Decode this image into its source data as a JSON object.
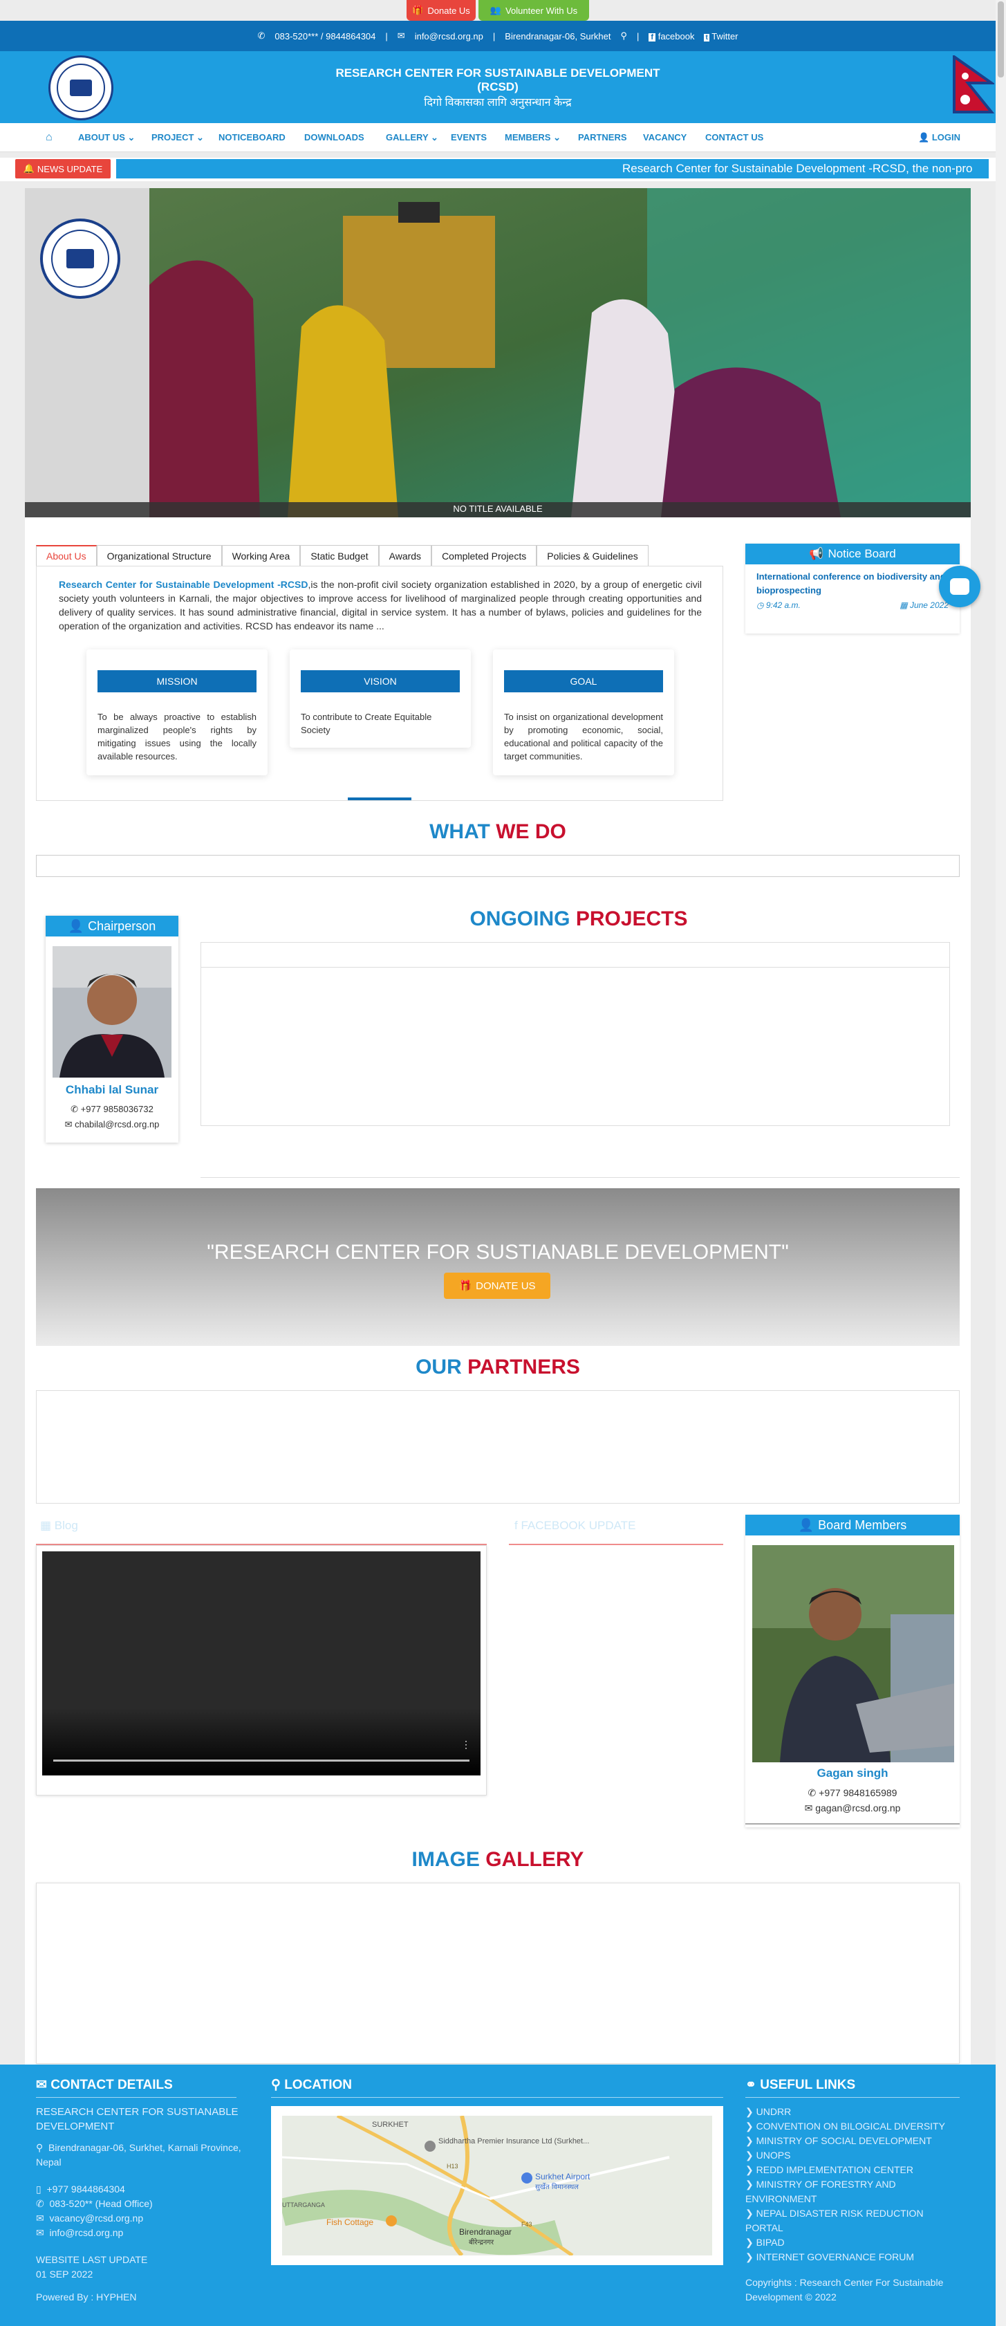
{
  "top": {
    "donate": "Donate Us",
    "volunteer": "Volunteer With Us"
  },
  "strip": {
    "phone": "083-520*** / 9844864304",
    "email": "info@rcsd.org.np",
    "address": "Birendranagar-06, Surkhet",
    "facebook": "facebook",
    "twitter": "Twitter"
  },
  "header": {
    "title": "RESEARCH CENTER FOR SUSTAINABLE DEVELOPMENT",
    "abbr": "(RCSD)",
    "nepali": "दिगो विकासका लागि अनुसन्धान केन्द्र"
  },
  "nav": {
    "items": [
      "ABOUT US",
      "PROJECT",
      "NOTICEBOARD",
      "DOWNLOADS",
      "GALLERY",
      "EVENTS",
      "MEMBERS",
      "PARTNERS",
      "VACANCY",
      "CONTACT US"
    ],
    "login": "LOGIN"
  },
  "news": {
    "label": "NEWS UPDATE",
    "ticker": "Research Center for Sustainable Development -RCSD, the non-pro"
  },
  "hero": {
    "caption": "NO TITLE AVAILABLE"
  },
  "about": {
    "tabs": [
      "About Us",
      "Organizational Structure",
      "Working Area",
      "Static Budget",
      "Awards",
      "Completed Projects",
      "Policies & Guidelines"
    ],
    "org_name": "Research Center for Sustainable Development -RCSD",
    "text": ",is the non-profit civil society organization established in 2020, by a group of energetic civil society youth volunteers in Karnali, the major objectives to improve access for livelihood of marginalized people through creating opportunities and delivery of quality services. It has sound administrative financial, digital in service system. It has a number of bylaws, policies and guidelines for the operation of the organization and activities. RCSD has endeavor its name ...",
    "cards": [
      {
        "title": "MISSION",
        "text": "To be always proactive to establish marginalized people's rights by mitigating issues using the locally available resources."
      },
      {
        "title": "VISION",
        "text": "To contribute to Create Equitable Society"
      },
      {
        "title": "GOAL",
        "text": "To insist on organizational development by promoting economic, social, educational and political capacity of the target communities."
      }
    ]
  },
  "notice": {
    "title": "Notice Board",
    "item": "International conference on biodiversity and bioprospecting",
    "time": "9:42 a.m.",
    "date": "June 2022"
  },
  "whatwedo": {
    "a": "WHAT",
    "b": "WE DO"
  },
  "chair": {
    "title": "Chairperson",
    "name": "Chhabi lal Sunar",
    "phone": "+977 9858036732",
    "email": "chabilal@rcsd.org.np"
  },
  "ongoing": {
    "a": "ONGOING",
    "b": "PROJECTS"
  },
  "banner": {
    "text": "\"RESEARCH CENTER FOR SUSTIANABLE DEVELOPMENT\"",
    "donate": "DONATE US"
  },
  "partners": {
    "a": "OUR",
    "b": "PARTNERS"
  },
  "blog": {
    "title": "Blog"
  },
  "fbupdate": {
    "title": "FACEBOOK UPDATE"
  },
  "board": {
    "title": "Board Members",
    "name": "Gagan singh",
    "phone": "+977 9848165989",
    "email": "gagan@rcsd.org.np"
  },
  "gallery": {
    "a": "IMAGE",
    "b": "GALLERY"
  },
  "footer": {
    "contact_title": "CONTACT DETAILS",
    "org": "RESEARCH CENTER FOR SUSTIANABLE DEVELOPMENT",
    "address": "Birendranagar-06, Surkhet, Karnali Province, Nepal",
    "phone1": "+977 9844864304",
    "phone2": "083-520** (Head Office)",
    "email1": "vacancy@rcsd.org.np",
    "email2": "info@rcsd.org.np",
    "update_label": "WEBSITE LAST UPDATE",
    "update_date": "01 SEP 2022",
    "powered": "Powered By : HYPHEN",
    "location_title": "LOCATION",
    "map_labels": {
      "surkhet": "SURKHET",
      "premier": "Siddhartha Premier Insurance Ltd (Surkhet...",
      "airport": "Surkhet Airport",
      "airport_np": "सुर्खेत विमानस्थल",
      "fish": "Fish Cottage",
      "birendranagar": "Birendranagar",
      "birendranagar_np": "बीरेन्द्रनगर",
      "uttarganga": "UTTARGANGA",
      "road1": "H13",
      "road2": "F43"
    },
    "links_title": "USEFUL LINKS",
    "links": [
      "UNDRR",
      "CONVENTION ON BILOGICAL DIVERSITY",
      "MINISTRY OF SOCIAL DEVELOPMENT",
      "UNOPS",
      "REDD IMPLEMENTATION CENTER",
      "MINISTRY OF FORESTRY AND ENVIRONMENT",
      "NEPAL DISASTER RISK REDUCTION PORTAL",
      "BIPAD",
      "INTERNET GOVERNANCE FORUM"
    ],
    "copyright": "Copyrights : Research Center For Sustainable Development © 2022"
  },
  "colors": {
    "primary": "#1e9ee0",
    "dark_blue": "#0e6fb6",
    "red": "#c8102e",
    "donate": "#e8453c",
    "volunteer": "#6dbb3c",
    "orange": "#f5a623"
  }
}
